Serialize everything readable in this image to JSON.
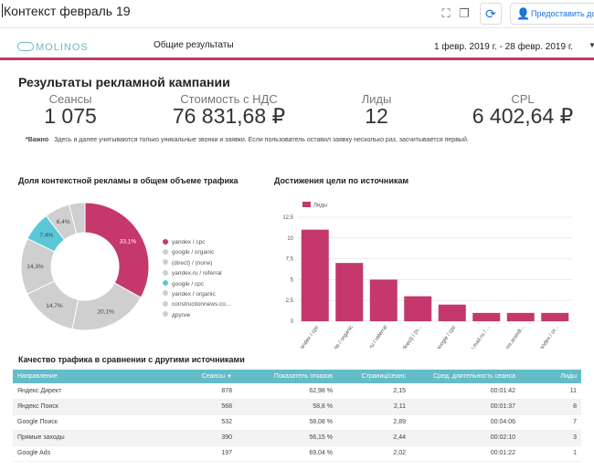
{
  "app": {
    "doc_title": "Контекст февраль 19",
    "share_label": "Предоставить доступ"
  },
  "header": {
    "logo_text": "MOLINOS",
    "report_tab": "Общие результаты",
    "date_range": "1 февр. 2019 г. - 28 февр. 2019 г."
  },
  "summary": {
    "title": "Результаты рекламной кампании",
    "kpis": [
      {
        "label": "Сеансы",
        "value": "1 075"
      },
      {
        "label": "Стоимость с НДС",
        "value": "76 831,68 ₽"
      },
      {
        "label": "Лиды",
        "value": "12"
      },
      {
        "label": "CPL",
        "value": "6 402,64 ₽"
      }
    ],
    "note_bold": "*Важно",
    "note_text": "Здесь и далее учитываются только уникальные звонки и заявки. Если пользователь оставил заявку несколько раз, засчитывается первый."
  },
  "colors": {
    "accent": "#c4386b",
    "table_header": "#63bcc8",
    "cyan": "#5bc8d8",
    "grey": "#d3d3d3"
  },
  "pie": {
    "title": "Доля контекстной рекламы в общем объеме трафика",
    "legend": [
      {
        "label": "yandex / cpc",
        "color": "#c4386b"
      },
      {
        "label": "google / organic",
        "color": "#cfcfcf"
      },
      {
        "label": "(direct) / (none)",
        "color": "#cfcfcf"
      },
      {
        "label": "yandex.ru / referral",
        "color": "#cfcfcf"
      },
      {
        "label": "google / cpc",
        "color": "#5bc8d8"
      },
      {
        "label": "yandex / organic",
        "color": "#cfcfcf"
      },
      {
        "label": "constructionnews.co...",
        "color": "#cfcfcf"
      },
      {
        "label": "другие",
        "color": "#cfcfcf"
      }
    ]
  },
  "bar": {
    "title": "Достижения цели по источникам"
  },
  "table": {
    "title": "Качество трафика в сравнении с другими источниками",
    "columns": [
      "Направление",
      "Сеансы",
      "Показатель отказов",
      "Страниц/сеанс",
      "Сред. длительность сеанса",
      "Лиды"
    ],
    "rows": [
      [
        "Яндекс Директ",
        "878",
        "62,98 %",
        "2,15",
        "00:01:42",
        "11"
      ],
      [
        "Яндекс Поиск",
        "568",
        "58,8 %",
        "2,11",
        "00:01:37",
        "8"
      ],
      [
        "Google Поиск",
        "532",
        "58,08 %",
        "2,89",
        "00:04:06",
        "7"
      ],
      [
        "Прямые заходы",
        "390",
        "56,15 %",
        "2,44",
        "00:02:10",
        "3"
      ],
      [
        "Google Ads",
        "197",
        "69,04 %",
        "2,02",
        "00:01:22",
        "1"
      ]
    ]
  },
  "chart_data": [
    {
      "type": "pie",
      "title": "",
      "slice_labels": [
        "33,1%",
        "20,1%",
        "14,7%",
        "14,3%",
        "7,4%",
        "6,4%"
      ],
      "slices": [
        {
          "value": 33.1,
          "color": "#c4386b"
        },
        {
          "value": 20.1,
          "color": "#cfcfcf"
        },
        {
          "value": 14.7,
          "color": "#cfcfcf"
        },
        {
          "value": 14.3,
          "color": "#cfcfcf"
        },
        {
          "value": 7.4,
          "color": "#5bc8d8"
        },
        {
          "value": 6.4,
          "color": "#cfcfcf"
        },
        {
          "value": 4.0,
          "color": "#cfcfcf"
        }
      ],
      "donut": true
    },
    {
      "type": "bar",
      "title": "",
      "categories": [
        "yandex / cpc",
        "google / organic",
        "yandex.ru / referral",
        "(direct) / (n...",
        "google / cpc",
        "go.mail.ru / ...",
        "crm.arandi...",
        "yandex / or..."
      ],
      "series": [
        {
          "name": "Лиды",
          "values": [
            11,
            7,
            5,
            3,
            2,
            1,
            1,
            1
          ],
          "color": "#c4386b"
        }
      ],
      "yticks": [
        "0",
        "2,5",
        "5",
        "7,5",
        "10",
        "12,5"
      ],
      "ylim": [
        0,
        12.5
      ],
      "grid": true,
      "legend": "top-left"
    }
  ]
}
